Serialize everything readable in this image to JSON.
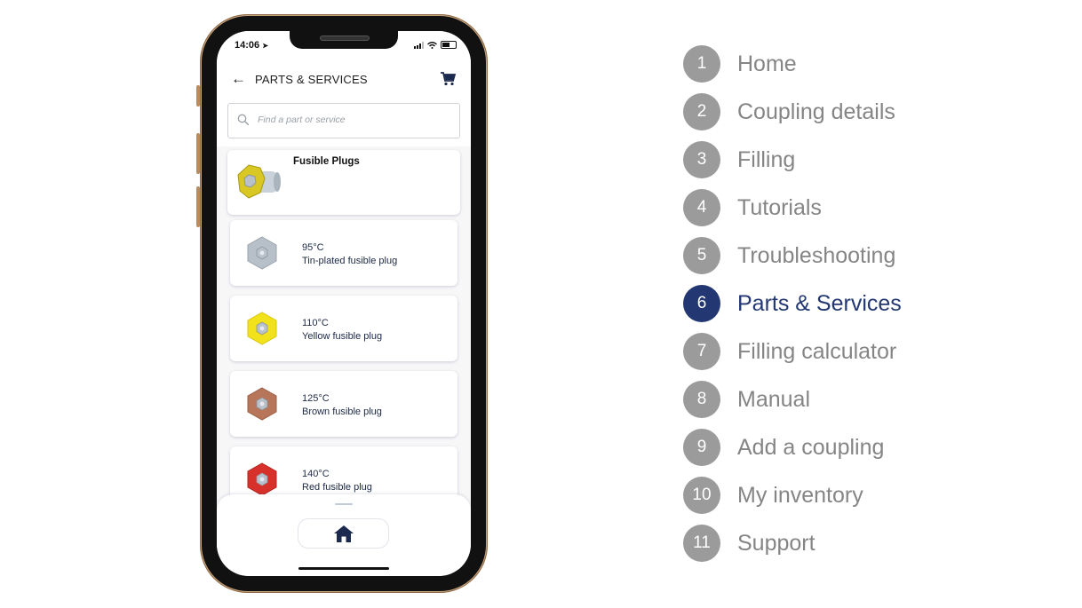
{
  "phone": {
    "status_bar": {
      "time": "14:06",
      "location_icon": "location-arrow-icon"
    },
    "header": {
      "title": "PARTS & SERVICES",
      "back_icon": "arrow-left-icon",
      "cart_icon": "cart-icon"
    },
    "search": {
      "placeholder": "Find a part or service",
      "value": ""
    },
    "category": {
      "title": "Fusible Plugs",
      "image": "yellow-fusible-plug-image"
    },
    "items": [
      {
        "temp": "95°C",
        "name": "Tin-plated fusible plug",
        "color": "#b7c0c8",
        "ring": "#9aa4ad"
      },
      {
        "temp": "110°C",
        "name": "Yellow fusible plug",
        "color": "#f2e21b",
        "ring": "#d8c70f"
      },
      {
        "temp": "125°C",
        "name": "Brown fusible plug",
        "color": "#b7765a",
        "ring": "#9a5f46"
      },
      {
        "temp": "140°C",
        "name": "Red fusible plug",
        "color": "#d8312b",
        "ring": "#b3221d"
      }
    ],
    "bottom_nav": {
      "home_icon": "home-icon"
    }
  },
  "legend": {
    "active_index": 6,
    "accent_color": "#233872",
    "items": [
      {
        "num": "1",
        "label": "Home"
      },
      {
        "num": "2",
        "label": "Coupling details"
      },
      {
        "num": "3",
        "label": "Filling"
      },
      {
        "num": "4",
        "label": "Tutorials"
      },
      {
        "num": "5",
        "label": "Troubleshooting"
      },
      {
        "num": "6",
        "label": "Parts & Services"
      },
      {
        "num": "7",
        "label": "Filling calculator"
      },
      {
        "num": "8",
        "label": "Manual"
      },
      {
        "num": "9",
        "label": "Add a coupling"
      },
      {
        "num": "10",
        "label": "My inventory"
      },
      {
        "num": "11",
        "label": "Support"
      }
    ]
  }
}
